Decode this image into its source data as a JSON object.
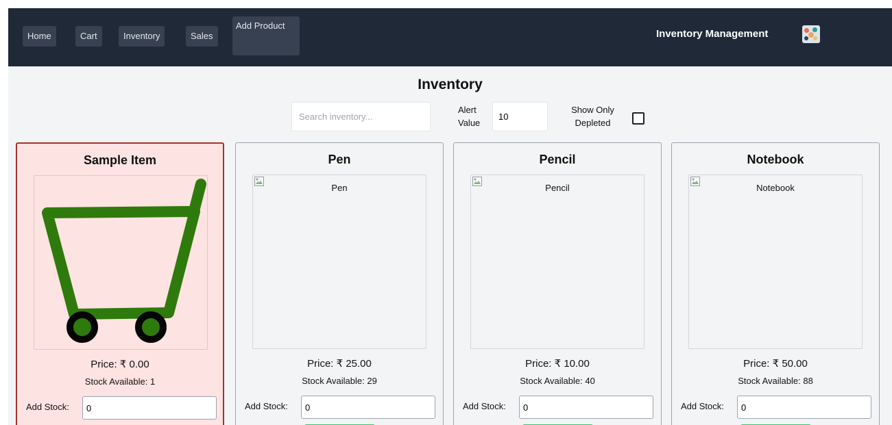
{
  "nav": {
    "items": [
      {
        "label": "Home"
      },
      {
        "label": "Cart"
      },
      {
        "label": "Inventory"
      },
      {
        "label": "Sales"
      },
      {
        "label": "Add Product"
      }
    ],
    "brand": "Inventory Management",
    "brand_icon": "app-logo-icon"
  },
  "inventory": {
    "title": "Inventory",
    "search_placeholder": "Search inventory...",
    "search_value": "",
    "alert_label": "Alert Value",
    "alert_value": "10",
    "depleted_label": "Show Only Depleted",
    "depleted_checked": false
  },
  "products": [
    {
      "name": "Sample Item",
      "image_alt": "",
      "price": "Price: ₹ 0.00",
      "stock": "Stock Available: 1",
      "add_label": "Add Stock:",
      "add_value": "0",
      "low_stock": true,
      "image_icon": "shopping-cart-icon"
    },
    {
      "name": "Pen",
      "image_alt": "Pen",
      "price": "Price: ₹ 25.00",
      "stock": "Stock Available: 29",
      "add_label": "Add Stock:",
      "add_value": "0",
      "low_stock": false,
      "image_icon": "broken-image-icon"
    },
    {
      "name": "Pencil",
      "image_alt": "Pencil",
      "price": "Price: ₹ 10.00",
      "stock": "Stock Available: 40",
      "add_label": "Add Stock:",
      "add_value": "0",
      "low_stock": false,
      "image_icon": "broken-image-icon"
    },
    {
      "name": "Notebook",
      "image_alt": "Notebook",
      "price": "Price: ₹ 50.00",
      "stock": "Stock Available: 88",
      "add_label": "Add Stock:",
      "add_value": "0",
      "low_stock": false,
      "image_icon": "broken-image-icon"
    }
  ],
  "colors": {
    "navbar_bg": "#1f2937",
    "nav_button_bg": "#374151",
    "alert_card_bg": "#fde3e1",
    "alert_card_border": "#a1342b",
    "add_button": "#34c46a",
    "cart_green": "#2f7a0c"
  }
}
